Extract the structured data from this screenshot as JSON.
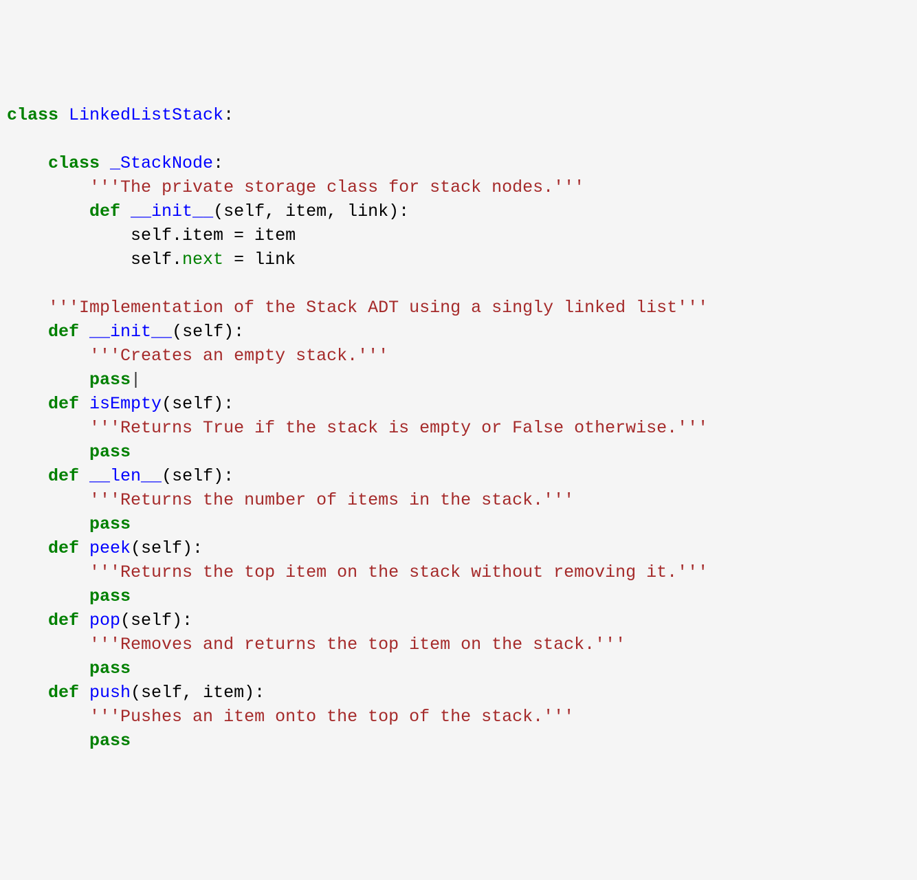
{
  "tokens": [
    {
      "t": "class ",
      "c": "kw"
    },
    {
      "t": "LinkedListStack",
      "c": "cls"
    },
    {
      "t": ":",
      "c": ""
    },
    {
      "t": "\n",
      "c": ""
    },
    {
      "t": "\n",
      "c": ""
    },
    {
      "t": "    ",
      "c": ""
    },
    {
      "t": "class ",
      "c": "kw"
    },
    {
      "t": "_StackNode",
      "c": "cls"
    },
    {
      "t": ":",
      "c": ""
    },
    {
      "t": "\n",
      "c": ""
    },
    {
      "t": "        ",
      "c": ""
    },
    {
      "t": "'''The private storage class for stack nodes.'''",
      "c": "str"
    },
    {
      "t": "\n",
      "c": ""
    },
    {
      "t": "        ",
      "c": ""
    },
    {
      "t": "def ",
      "c": "kw"
    },
    {
      "t": "__init__",
      "c": "fn"
    },
    {
      "t": "(self, item, link):",
      "c": ""
    },
    {
      "t": "\n",
      "c": ""
    },
    {
      "t": "            self.item = item",
      "c": ""
    },
    {
      "t": "\n",
      "c": ""
    },
    {
      "t": "            self.",
      "c": ""
    },
    {
      "t": "next",
      "c": "builtin"
    },
    {
      "t": " = link",
      "c": ""
    },
    {
      "t": "\n",
      "c": ""
    },
    {
      "t": "\n",
      "c": ""
    },
    {
      "t": "    ",
      "c": ""
    },
    {
      "t": "'''Implementation of the Stack ADT using a singly linked list'''",
      "c": "str"
    },
    {
      "t": "\n",
      "c": ""
    },
    {
      "t": "    ",
      "c": ""
    },
    {
      "t": "def ",
      "c": "kw"
    },
    {
      "t": "__init__",
      "c": "fn"
    },
    {
      "t": "(self):",
      "c": ""
    },
    {
      "t": "\n",
      "c": ""
    },
    {
      "t": "        ",
      "c": ""
    },
    {
      "t": "'''Creates an empty stack.'''",
      "c": "str"
    },
    {
      "t": "\n",
      "c": ""
    },
    {
      "t": "        ",
      "c": ""
    },
    {
      "t": "pass",
      "c": "kw"
    },
    {
      "t": "|",
      "c": "cursor-char"
    },
    {
      "t": "\n",
      "c": ""
    },
    {
      "t": "    ",
      "c": ""
    },
    {
      "t": "def ",
      "c": "kw"
    },
    {
      "t": "isEmpty",
      "c": "fn"
    },
    {
      "t": "(self):",
      "c": ""
    },
    {
      "t": "\n",
      "c": ""
    },
    {
      "t": "        ",
      "c": ""
    },
    {
      "t": "'''Returns True if the stack is empty or False otherwise.'''",
      "c": "str"
    },
    {
      "t": "\n",
      "c": ""
    },
    {
      "t": "        ",
      "c": ""
    },
    {
      "t": "pass",
      "c": "kw"
    },
    {
      "t": "\n",
      "c": ""
    },
    {
      "t": "    ",
      "c": ""
    },
    {
      "t": "def ",
      "c": "kw"
    },
    {
      "t": "__len__",
      "c": "fn"
    },
    {
      "t": "(self):",
      "c": ""
    },
    {
      "t": "\n",
      "c": ""
    },
    {
      "t": "        ",
      "c": ""
    },
    {
      "t": "'''Returns the number of items in the stack.'''",
      "c": "str"
    },
    {
      "t": "\n",
      "c": ""
    },
    {
      "t": "        ",
      "c": ""
    },
    {
      "t": "pass",
      "c": "kw"
    },
    {
      "t": "\n",
      "c": ""
    },
    {
      "t": "    ",
      "c": ""
    },
    {
      "t": "def ",
      "c": "kw"
    },
    {
      "t": "peek",
      "c": "fn"
    },
    {
      "t": "(self):",
      "c": ""
    },
    {
      "t": "\n",
      "c": ""
    },
    {
      "t": "        ",
      "c": ""
    },
    {
      "t": "'''Returns the top item on the stack without removing it.'''",
      "c": "str"
    },
    {
      "t": "\n",
      "c": ""
    },
    {
      "t": "        ",
      "c": ""
    },
    {
      "t": "pass",
      "c": "kw"
    },
    {
      "t": "\n",
      "c": ""
    },
    {
      "t": "    ",
      "c": ""
    },
    {
      "t": "def ",
      "c": "kw"
    },
    {
      "t": "pop",
      "c": "fn"
    },
    {
      "t": "(self):",
      "c": ""
    },
    {
      "t": "\n",
      "c": ""
    },
    {
      "t": "        ",
      "c": ""
    },
    {
      "t": "'''Removes and returns the top item on the stack.'''",
      "c": "str"
    },
    {
      "t": "\n",
      "c": ""
    },
    {
      "t": "        ",
      "c": ""
    },
    {
      "t": "pass",
      "c": "kw"
    },
    {
      "t": "\n",
      "c": ""
    },
    {
      "t": "    ",
      "c": ""
    },
    {
      "t": "def ",
      "c": "kw"
    },
    {
      "t": "push",
      "c": "fn"
    },
    {
      "t": "(self, item):",
      "c": ""
    },
    {
      "t": "\n",
      "c": ""
    },
    {
      "t": "        ",
      "c": ""
    },
    {
      "t": "'''Pushes an item onto the top of the stack.'''",
      "c": "str"
    },
    {
      "t": "\n",
      "c": ""
    },
    {
      "t": "        ",
      "c": ""
    },
    {
      "t": "pass",
      "c": "kw"
    }
  ]
}
